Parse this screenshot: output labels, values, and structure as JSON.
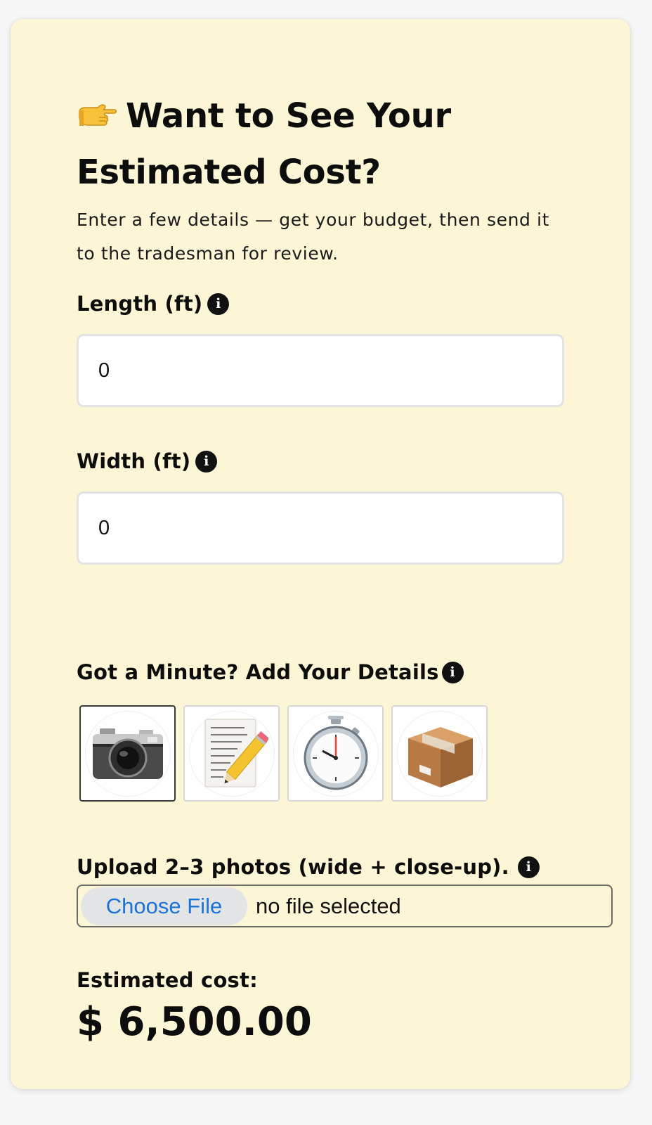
{
  "header": {
    "title_line1": "Want to See Your",
    "title_line2": "Estimated Cost?",
    "subtitle": "Enter a few details — get your budget, then send it to the tradesman for review."
  },
  "length": {
    "label": "Length (ft)",
    "value": "0"
  },
  "width": {
    "label": "Width (ft)",
    "value": "0"
  },
  "details": {
    "label": "Got a Minute? Add Your Details",
    "options": [
      {
        "name": "camera",
        "icon": "camera-icon",
        "selected": true
      },
      {
        "name": "notes",
        "icon": "memo-pencil-icon",
        "selected": false
      },
      {
        "name": "timer",
        "icon": "stopwatch-icon",
        "selected": false
      },
      {
        "name": "package",
        "icon": "package-box-icon",
        "selected": false
      }
    ]
  },
  "upload": {
    "label": "Upload 2–3 photos (wide + close-up).",
    "button_label": "Choose File",
    "status": "no file selected"
  },
  "estimate": {
    "label": "Estimated cost:",
    "value": "$ 6,500.00"
  },
  "colors": {
    "card_background": "#fdf6d6",
    "link_blue": "#1a73d8"
  }
}
